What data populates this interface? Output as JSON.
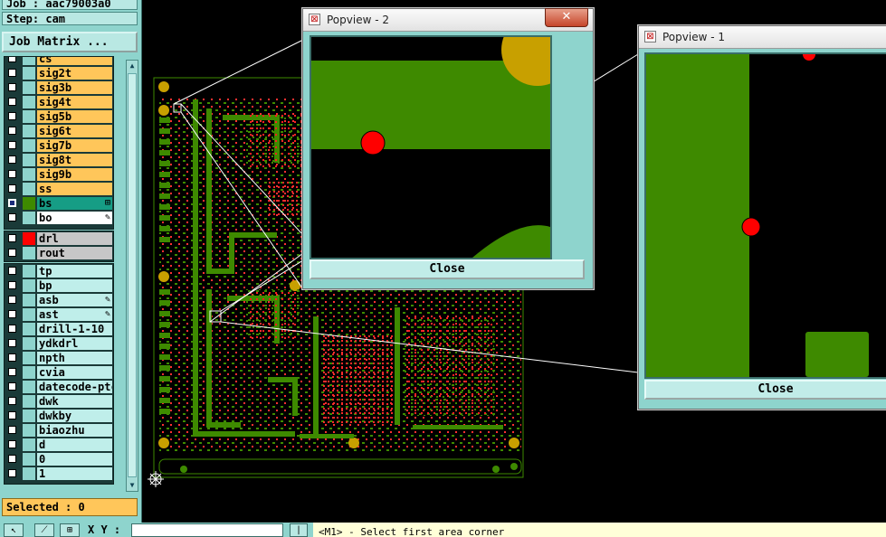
{
  "header": {
    "job_line": "Job : aac79003a0",
    "step_line": "Step: cam",
    "job_matrix_button": "Job Matrix ..."
  },
  "layers": {
    "signal": [
      {
        "name": "cs",
        "color": "orange"
      },
      {
        "name": "sig2t",
        "color": "orange"
      },
      {
        "name": "sig3b",
        "color": "orange"
      },
      {
        "name": "sig4t",
        "color": "orange"
      },
      {
        "name": "sig5b",
        "color": "orange"
      },
      {
        "name": "sig6t",
        "color": "orange"
      },
      {
        "name": "sig7b",
        "color": "orange"
      },
      {
        "name": "sig8t",
        "color": "orange"
      },
      {
        "name": "sig9b",
        "color": "orange"
      },
      {
        "name": "ss",
        "color": "orange"
      },
      {
        "name": "bs",
        "color": "teal",
        "active": true,
        "mark": "⊞"
      },
      {
        "name": "bo",
        "color": "white",
        "mark": "✎"
      }
    ],
    "drill": [
      {
        "name": "drl",
        "color": "grey",
        "swatch": "red"
      },
      {
        "name": "rout",
        "color": "grey"
      }
    ],
    "misc": [
      {
        "name": "tp",
        "color": "cyan"
      },
      {
        "name": "bp",
        "color": "cyan"
      },
      {
        "name": "asb",
        "color": "cyan",
        "mark": "✎"
      },
      {
        "name": "ast",
        "color": "cyan",
        "mark": "✎"
      },
      {
        "name": "drill-1-10",
        "color": "cyan"
      },
      {
        "name": "ydkdrl",
        "color": "cyan"
      },
      {
        "name": "npth",
        "color": "cyan"
      },
      {
        "name": "cvia",
        "color": "cyan"
      },
      {
        "name": "datecode-ptc",
        "color": "cyan"
      },
      {
        "name": "dwk",
        "color": "cyan"
      },
      {
        "name": "dwkby",
        "color": "cyan"
      },
      {
        "name": "biaozhu",
        "color": "cyan"
      },
      {
        "name": "d",
        "color": "cyan"
      },
      {
        "name": "0",
        "color": "cyan"
      },
      {
        "name": "1",
        "color": "cyan"
      }
    ]
  },
  "selected_text": "Selected : 0",
  "bottom_bar": {
    "xy_label": "X Y :",
    "status": "<M1> - Select first area corner"
  },
  "popview2": {
    "title": "Popview - 2",
    "close_label": "Close",
    "close_x": "✕"
  },
  "popview1": {
    "title": "Popview - 1",
    "close_label": "Close"
  },
  "colors": {
    "panel": "#8ed4cd",
    "copper": "#3e8a00",
    "pad": "#c8a000",
    "drill": "#ff0000",
    "layer_orange": "#ffc65a"
  }
}
